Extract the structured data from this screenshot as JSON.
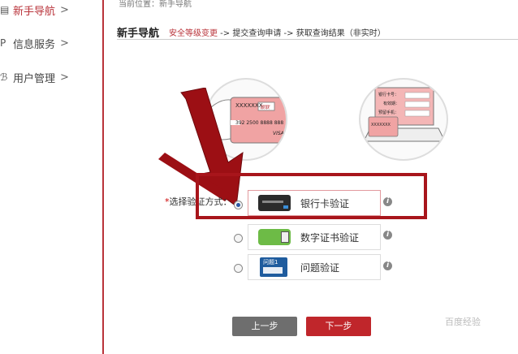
{
  "sidebar": {
    "items": [
      {
        "label": "新手导航",
        "arrow": ">"
      },
      {
        "label": "信息服务",
        "arrow": ">"
      },
      {
        "label": "用户管理",
        "arrow": ">"
      }
    ]
  },
  "breadcrumb": "当前位置：新手导航",
  "section": {
    "title": "新手导航"
  },
  "steps": {
    "step1": "安全等级变更",
    "sep1": " -> ",
    "step2": "提交查询申请",
    "sep2": " -> ",
    "step3": "获取查询结果（非实时）"
  },
  "card_illustration": {
    "number": "XXXXXXX",
    "brand": "银联",
    "digits": "392 2500 8888 888",
    "network": "VISA"
  },
  "form_illustration": {
    "field1": "银行卡号：",
    "field2": "有效期：",
    "field3": "预留手机：",
    "card_number": "XXXXXXX"
  },
  "verify": {
    "star": "*",
    "label": "选择验证方式：",
    "options": [
      {
        "text": "银行卡验证",
        "selected": true
      },
      {
        "text": "数字证书验证",
        "selected": false
      },
      {
        "text": "问题验证",
        "selected": false
      }
    ],
    "question_thumb": "问题1"
  },
  "buttons": {
    "prev": "上一步",
    "next": "下一步"
  },
  "watermark": "百度经验",
  "colors": {
    "accent": "#b9333a",
    "highlight_frame": "#a8151b",
    "next_button": "#c0262b",
    "prev_button": "#6e6e6e"
  }
}
